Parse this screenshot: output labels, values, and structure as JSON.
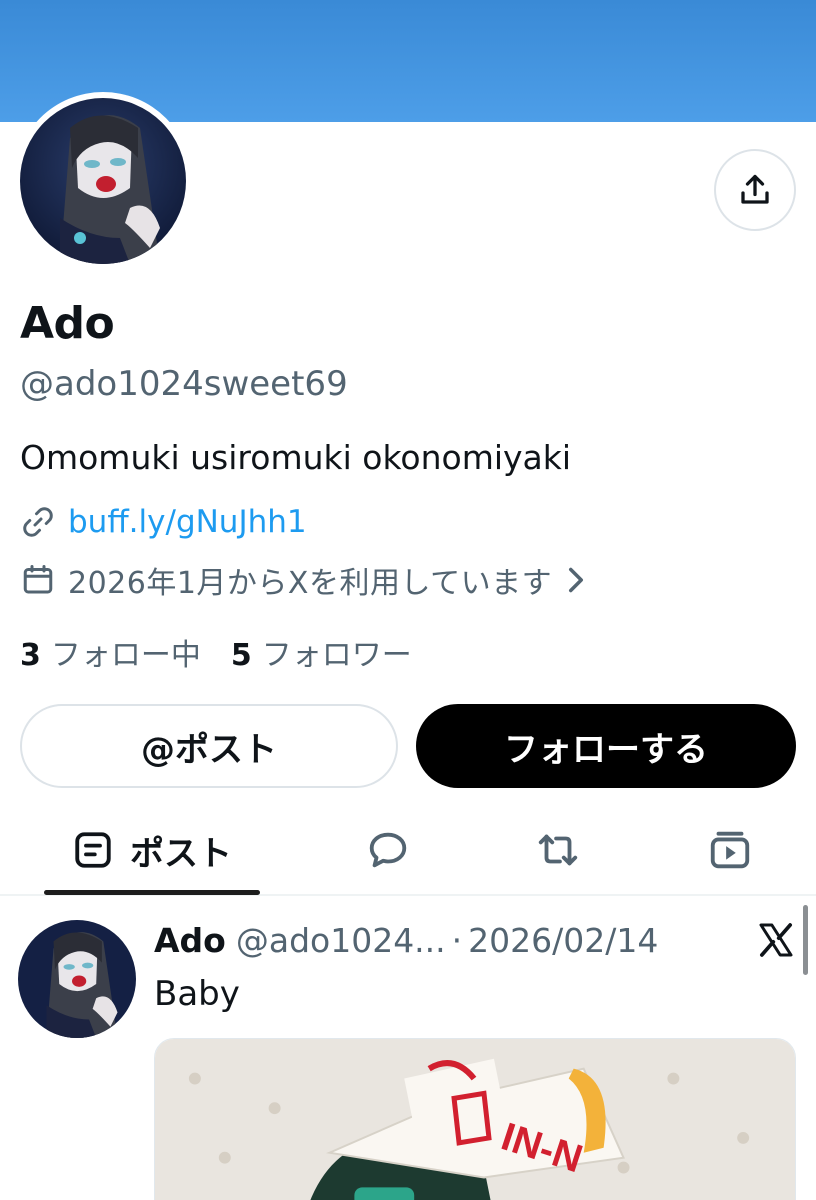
{
  "profile": {
    "name": "Ado",
    "handle": "@ado1024sweet69",
    "bio": "Omomuki usiromuki okonomiyaki",
    "link": "buff.ly/gNuJhh1",
    "joined": "2026年1月からXを利用しています",
    "following_count": "3",
    "following_label": "フォロー中",
    "followers_count": "5",
    "followers_label": "フォロワー"
  },
  "actions": {
    "mention_label": "@ポスト",
    "follow_label": "フォローする"
  },
  "tabs": {
    "posts_label": "ポスト"
  },
  "post": {
    "name": "Ado",
    "handle": "@ado1024...",
    "separator": "·",
    "date": "2026/02/14",
    "text": "Baby"
  },
  "icons": {
    "share": "share-icon",
    "link": "link-icon",
    "calendar": "calendar-icon",
    "chevron": "chevron-right-icon",
    "posts_tab": "posts-tab-icon",
    "replies_tab": "speech-bubble-icon",
    "reposts_tab": "repost-icon",
    "media_tab": "video-icon",
    "x_logo": "x-logo-icon"
  },
  "colors": {
    "banner": "#4d9ee8",
    "link": "#1d9bf0",
    "secondary_text": "#536471",
    "follow_button": "#000000"
  }
}
